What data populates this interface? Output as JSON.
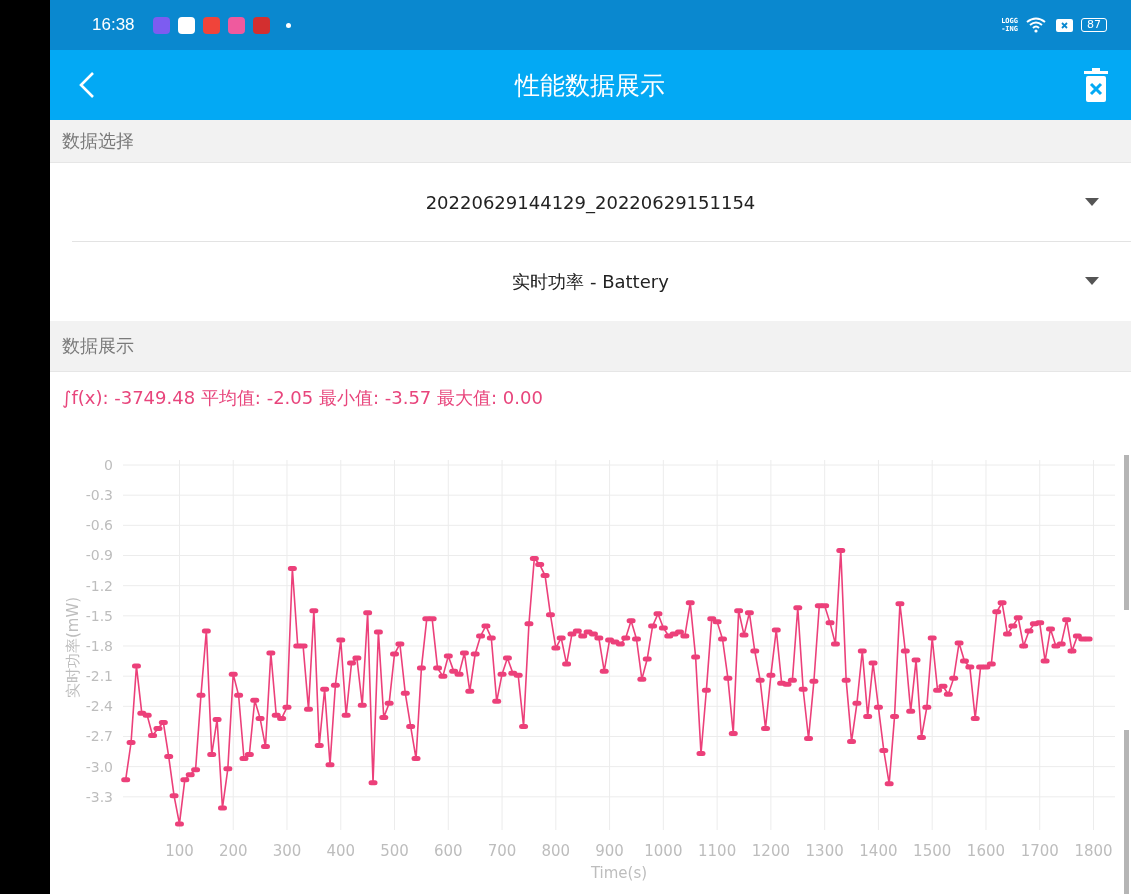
{
  "status_bar": {
    "time": "16:38",
    "logging_label": [
      "LOGG",
      "-ING"
    ],
    "battery": "87"
  },
  "app_bar": {
    "title": "性能数据展示"
  },
  "selection_section": {
    "header": "数据选择",
    "dropdowns": [
      {
        "value": "20220629144129_20220629151154"
      },
      {
        "value": "实时功率 - Battery"
      }
    ]
  },
  "display_section": {
    "header": "数据展示",
    "summary": "∫f(x): -3749.48 平均值: -2.05 最小值: -3.57 最大值: 0.00",
    "chart_data": {
      "type": "line",
      "grid": true,
      "xlabel": "Time(s)",
      "ylabel": "实时功率(mW)",
      "xlim": [
        -5,
        1840
      ],
      "ylim": [
        -3.63,
        0
      ],
      "xticks": [
        100,
        200,
        300,
        400,
        500,
        600,
        700,
        800,
        900,
        1000,
        1100,
        1200,
        1300,
        1400,
        1500,
        1600,
        1700,
        1800
      ],
      "yticks": [
        0,
        -0.3,
        -0.6,
        -0.9,
        -1.2,
        -1.5,
        -1.8,
        -2.1,
        -2.4,
        -2.7,
        {
          "value": -3,
          "label": "-3.0"
        },
        -3.3
      ],
      "x": [
        0,
        10,
        20,
        30,
        40,
        50,
        60,
        70,
        80,
        90,
        100,
        110,
        120,
        130,
        140,
        150,
        160,
        170,
        180,
        190,
        200,
        210,
        220,
        230,
        240,
        250,
        260,
        270,
        280,
        290,
        300,
        310,
        320,
        330,
        340,
        350,
        360,
        370,
        380,
        390,
        400,
        410,
        420,
        430,
        440,
        450,
        460,
        470,
        480,
        490,
        500,
        510,
        520,
        530,
        540,
        550,
        560,
        570,
        580,
        590,
        600,
        610,
        620,
        630,
        640,
        650,
        660,
        670,
        680,
        690,
        700,
        710,
        720,
        730,
        740,
        750,
        760,
        770,
        780,
        790,
        800,
        810,
        820,
        830,
        840,
        850,
        860,
        870,
        880,
        890,
        900,
        910,
        920,
        930,
        940,
        950,
        960,
        970,
        980,
        990,
        1000,
        1010,
        1020,
        1030,
        1040,
        1050,
        1060,
        1070,
        1080,
        1090,
        1100,
        1110,
        1120,
        1130,
        1140,
        1150,
        1160,
        1170,
        1180,
        1190,
        1200,
        1210,
        1220,
        1230,
        1240,
        1250,
        1260,
        1270,
        1280,
        1290,
        1300,
        1310,
        1320,
        1330,
        1340,
        1350,
        1360,
        1370,
        1380,
        1390,
        1400,
        1410,
        1420,
        1430,
        1440,
        1450,
        1460,
        1470,
        1480,
        1490,
        1500,
        1510,
        1520,
        1530,
        1540,
        1550,
        1560,
        1570,
        1580,
        1590,
        1600,
        1610,
        1620,
        1630,
        1640,
        1650,
        1660,
        1670,
        1680,
        1690,
        1700,
        1710,
        1720,
        1730,
        1740,
        1750,
        1760,
        1770,
        1780,
        1790
      ],
      "series": [
        {
          "color": "#ec407a",
          "values": [
            -3.13,
            -2.76,
            -2.0,
            -2.47,
            -2.49,
            -2.69,
            -2.62,
            -2.56,
            -2.9,
            -3.29,
            -3.57,
            -3.13,
            -3.08,
            -3.03,
            -2.29,
            -1.65,
            -2.88,
            -2.53,
            -3.41,
            -3.02,
            -2.08,
            -2.29,
            -2.92,
            -2.88,
            -2.34,
            -2.52,
            -2.8,
            -1.87,
            -2.49,
            -2.52,
            -2.41,
            -1.03,
            -1.8,
            -1.8,
            -2.43,
            -1.45,
            -2.79,
            -2.23,
            -2.98,
            -2.19,
            -1.74,
            -2.49,
            -1.97,
            -1.92,
            -2.39,
            -1.47,
            -3.16,
            -1.66,
            -2.51,
            -2.37,
            -1.88,
            -1.78,
            -2.27,
            -2.6,
            -2.92,
            -2.02,
            -1.53,
            -1.53,
            -2.02,
            -2.1,
            -1.9,
            -2.05,
            -2.08,
            -1.87,
            -2.25,
            -1.88,
            -1.7,
            -1.6,
            -1.72,
            -2.35,
            -2.08,
            -1.92,
            -2.07,
            -2.09,
            -2.6,
            -1.58,
            -0.93,
            -0.99,
            -1.1,
            -1.49,
            -1.82,
            -1.72,
            -1.98,
            -1.68,
            -1.65,
            -1.7,
            -1.66,
            -1.68,
            -1.72,
            -2.05,
            -1.74,
            -1.76,
            -1.78,
            -1.72,
            -1.55,
            -1.73,
            -2.13,
            -1.93,
            -1.6,
            -1.48,
            -1.62,
            -1.7,
            -1.68,
            -1.66,
            -1.7,
            -1.37,
            -1.91,
            -2.87,
            -2.24,
            -1.53,
            -1.56,
            -1.73,
            -2.12,
            -2.67,
            -1.45,
            -1.69,
            -1.47,
            -1.85,
            -2.14,
            -2.62,
            -2.09,
            -1.64,
            -2.17,
            -2.18,
            -2.14,
            -1.42,
            -2.23,
            -2.72,
            -2.15,
            -1.4,
            -1.4,
            -1.57,
            -1.78,
            -0.85,
            -2.14,
            -2.75,
            -2.37,
            -1.85,
            -2.5,
            -1.97,
            -2.41,
            -2.84,
            -3.17,
            -2.5,
            -1.38,
            -1.85,
            -2.45,
            -1.94,
            -2.71,
            -2.41,
            -1.72,
            -2.24,
            -2.2,
            -2.28,
            -2.12,
            -1.77,
            -1.95,
            -2.01,
            -2.52,
            -2.01,
            -2.01,
            -1.98,
            -1.46,
            -1.37,
            -1.68,
            -1.6,
            -1.52,
            -1.8,
            -1.65,
            -1.58,
            -1.57,
            -1.95,
            -1.63,
            -1.8,
            -1.78,
            -1.54,
            -1.85,
            -1.7,
            -1.73,
            -1.73
          ]
        }
      ]
    }
  }
}
